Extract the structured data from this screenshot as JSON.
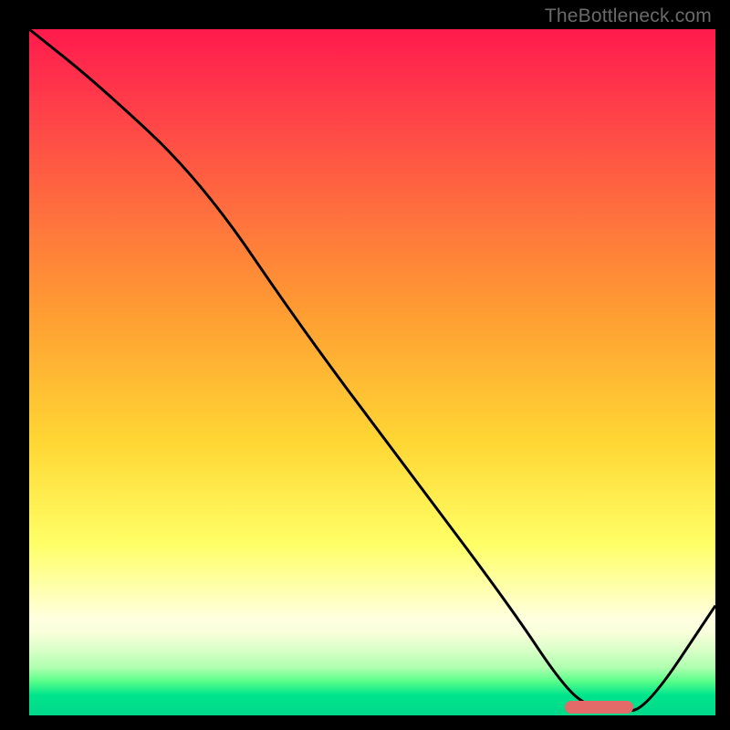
{
  "watermark": "TheBottleneck.com",
  "colors": {
    "frame_bg": "#000000",
    "curve_stroke": "#000000",
    "pill_fill": "#e46a6a"
  },
  "chart_data": {
    "type": "line",
    "title": "",
    "xlabel": "",
    "ylabel": "",
    "xlim": [
      0,
      100
    ],
    "ylim": [
      0,
      100
    ],
    "grid": false,
    "legend": false,
    "series": [
      {
        "name": "bottleneck-curve",
        "x": [
          0,
          10,
          25,
          40,
          55,
          70,
          78,
          82,
          86,
          90,
          100
        ],
        "values": [
          100,
          92,
          78,
          56,
          36,
          16,
          4,
          1,
          0.5,
          1,
          16
        ]
      }
    ],
    "marker": {
      "name": "optimal-range-pill",
      "x_start": 78,
      "x_end": 88,
      "y": 1.2
    },
    "gradient_stops": [
      {
        "pct": 0,
        "color": "#ff1a4d"
      },
      {
        "pct": 25,
        "color": "#ff6a3f"
      },
      {
        "pct": 60,
        "color": "#ffd633"
      },
      {
        "pct": 82,
        "color": "#ffffb3"
      },
      {
        "pct": 95,
        "color": "#5aff8a"
      },
      {
        "pct": 100,
        "color": "#00d88a"
      }
    ]
  }
}
